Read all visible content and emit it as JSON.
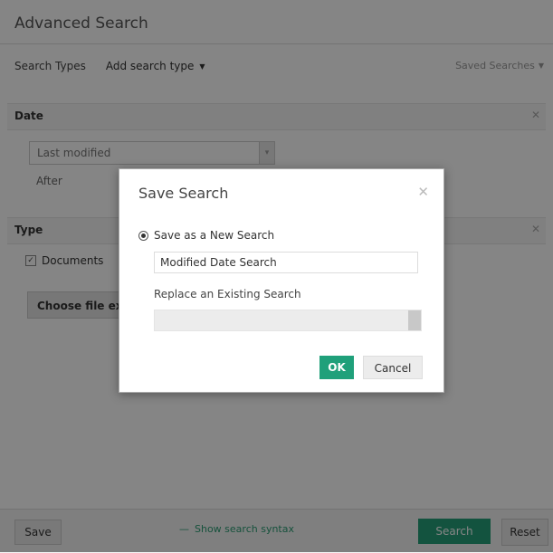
{
  "page": {
    "title": "Advanced Search",
    "search_types_label": "Search Types",
    "add_search_type_label": "Add search type",
    "saved_searches_label": "Saved Searches"
  },
  "date_section": {
    "title": "Date",
    "last_modified_label": "Last modified",
    "after_label": "After"
  },
  "type_section": {
    "title": "Type",
    "documents_label": "Documents",
    "choose_file_ext_label": "Choose file ext"
  },
  "footer": {
    "save_label": "Save",
    "show_syntax_label": "Show search syntax",
    "search_label": "Search",
    "reset_label": "Reset"
  },
  "dialog": {
    "title": "Save Search",
    "save_new_label": "Save as a New Search",
    "name_value": "Modified Date Search",
    "replace_label": "Replace an Existing Search",
    "ok_label": "OK",
    "cancel_label": "Cancel"
  },
  "colors": {
    "accent": "#25a07a",
    "overlay": "#000000"
  },
  "icons": {
    "close": "close-icon",
    "caret": "caret-down-icon",
    "minus": "minus-icon"
  }
}
